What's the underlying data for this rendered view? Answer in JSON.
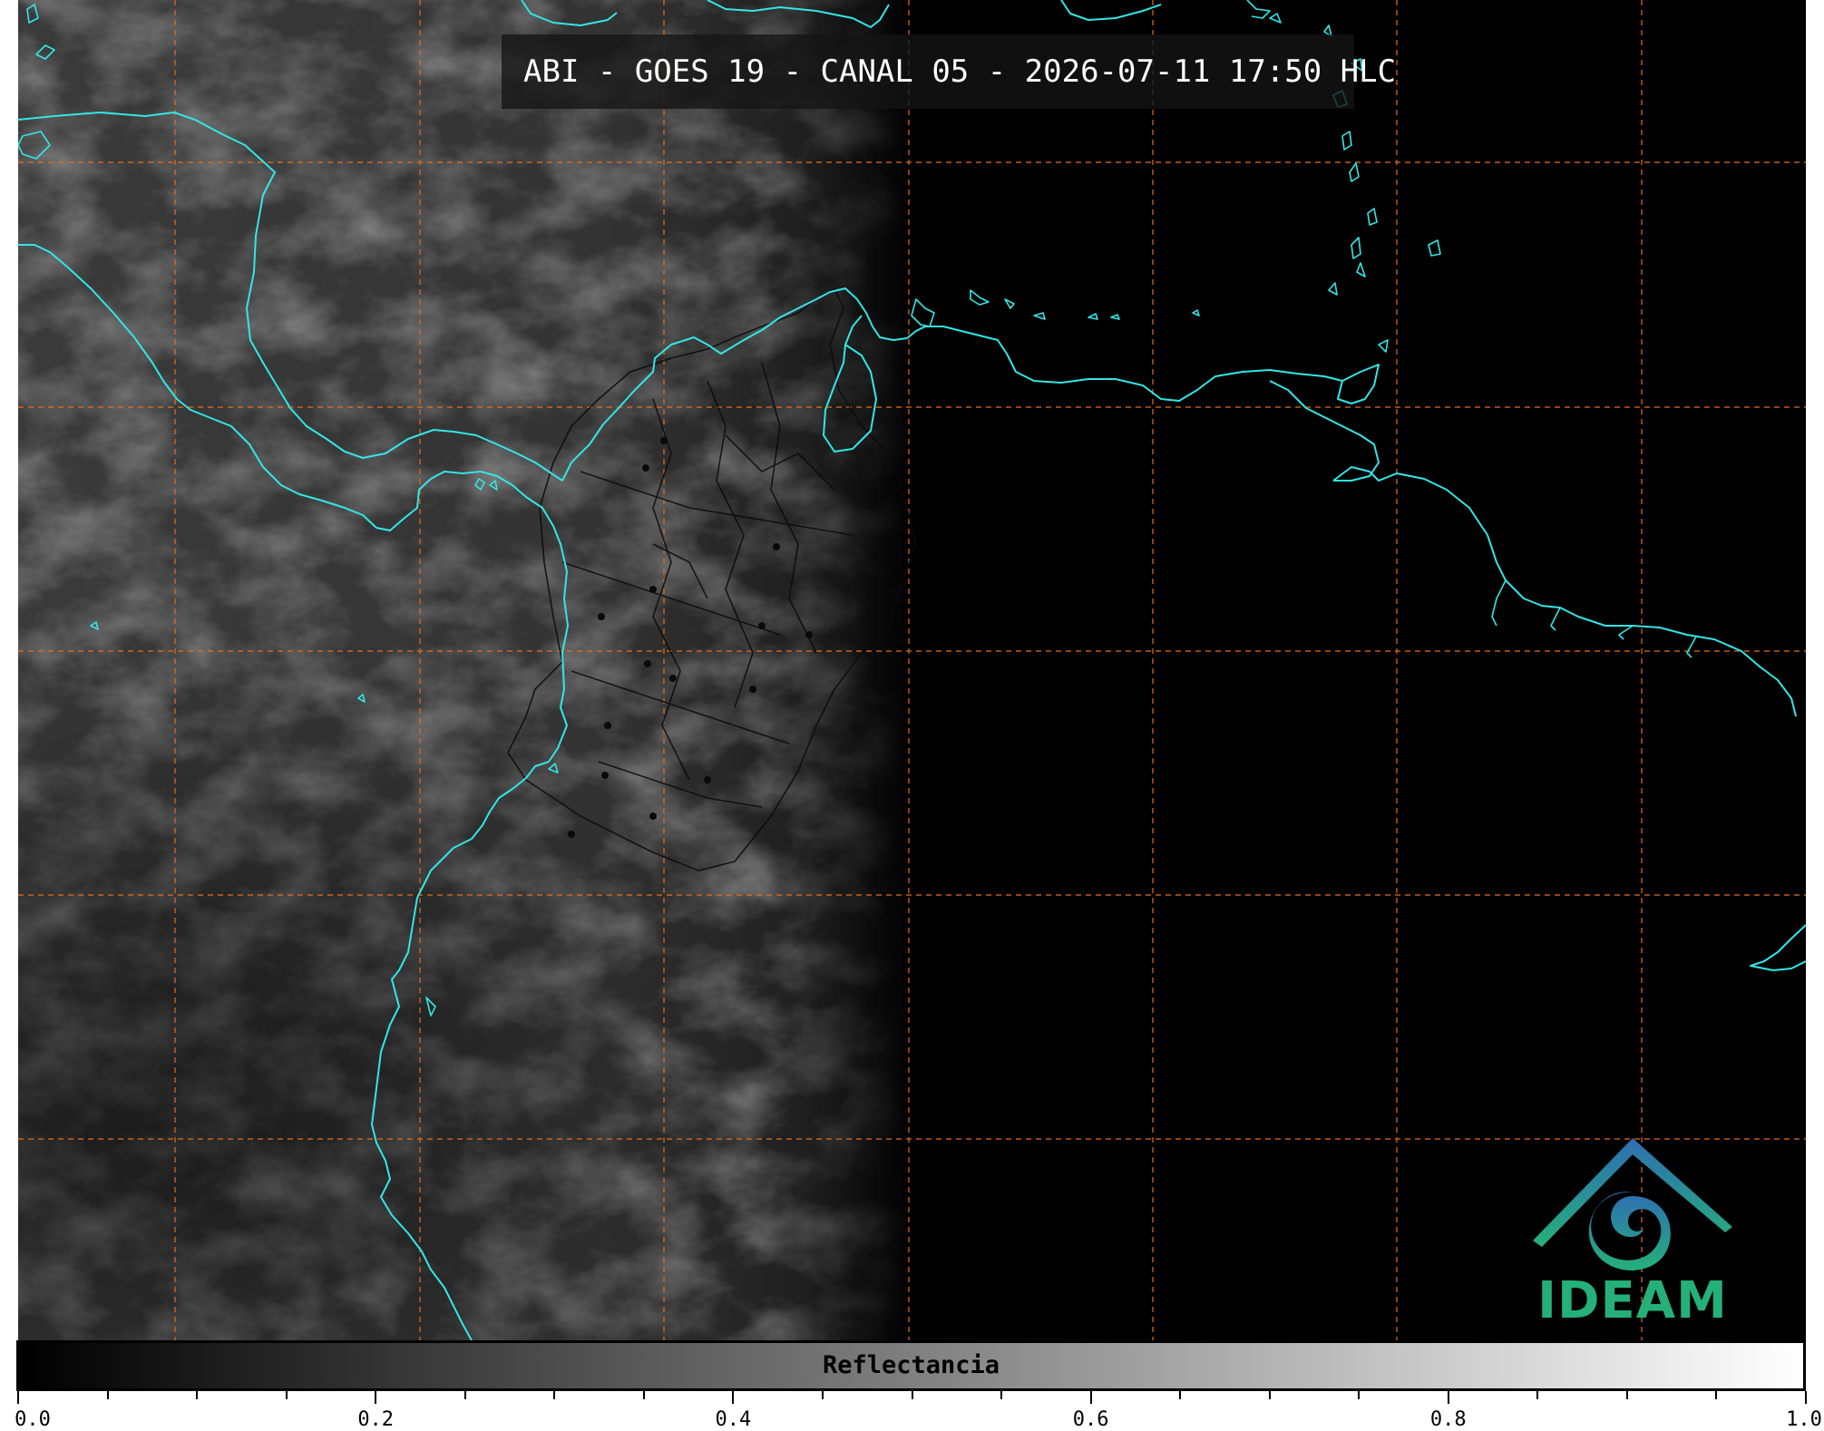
{
  "title": "ABI - GOES 19 - CANAL 05 - 2026-07-11 17:50 HLC",
  "colorbar": {
    "label": "Reflectancia",
    "min": 0.0,
    "max": 1.0,
    "gradient": [
      "#000000",
      "#ffffff"
    ],
    "tick_labels": [
      "0.0",
      "0.2",
      "0.4",
      "0.6",
      "0.8",
      "1.0"
    ],
    "major_ticks": [
      0.0,
      0.2,
      0.4,
      0.6,
      0.8,
      1.0
    ],
    "minor_step": 0.05
  },
  "logo": {
    "text": "IDEAM",
    "color_top": "#2f6db3",
    "color_bottom": "#25b07a",
    "icon": "ideam-swirl-icon"
  },
  "map": {
    "coastline_color": "#33e6e6",
    "graticule_color": "#e07020",
    "borders_color": "#0a0a0a",
    "daylit_tone": "#3a3a3a",
    "night_tone": "#000000"
  }
}
